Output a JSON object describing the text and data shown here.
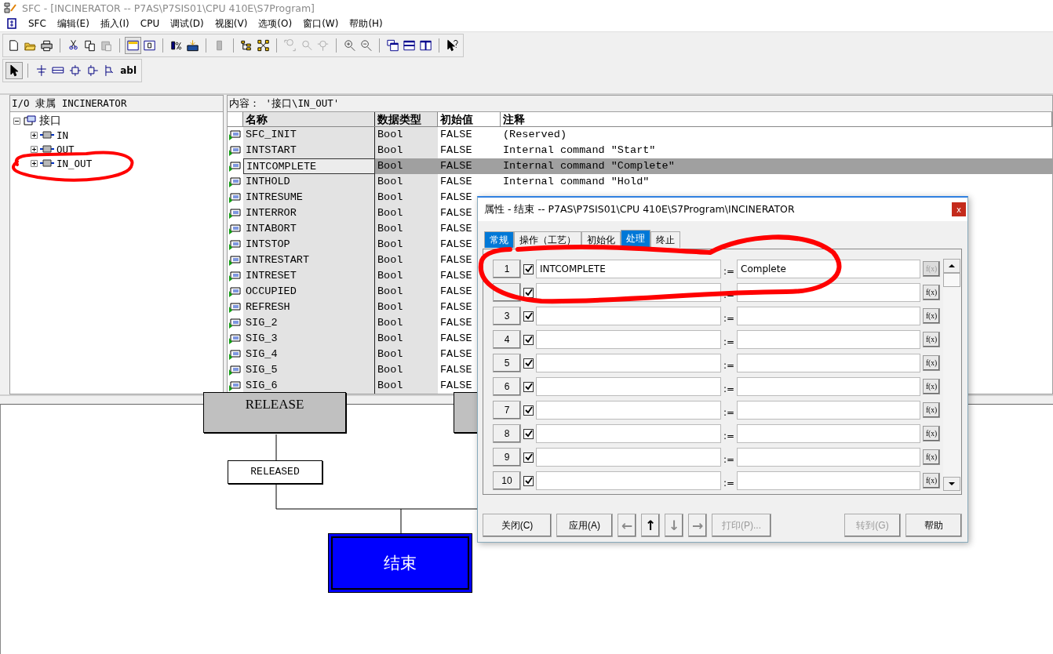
{
  "window": {
    "title": "SFC - [INCINERATOR -- P7AS\\P7SIS01\\CPU 410E\\S7Program]"
  },
  "menu": [
    "SFC",
    "编辑(E)",
    "插入(I)",
    "CPU",
    "调试(D)",
    "视图(V)",
    "选项(O)",
    "窗口(W)",
    "帮助(H)"
  ],
  "drawing_toolbar": {
    "text_tool": "abl"
  },
  "tree": {
    "header": "I/O 隶属 INCINERATOR",
    "items": [
      {
        "label": "接口",
        "expanded": true,
        "children": [
          {
            "label": "IN",
            "expanded": false
          },
          {
            "label": "OUT",
            "expanded": false
          },
          {
            "label": "IN_OUT",
            "expanded": false
          }
        ]
      }
    ]
  },
  "table": {
    "caption": "内容： '接口\\IN_OUT'",
    "columns": [
      "名称",
      "数据类型",
      "初始值",
      "注释"
    ],
    "rows": [
      {
        "name": "SFC_INIT",
        "type": "Bool",
        "initial": "FALSE",
        "comment": "(Reserved)",
        "selected": false
      },
      {
        "name": "INTSTART",
        "type": "Bool",
        "initial": "FALSE",
        "comment": "Internal command \"Start\"",
        "selected": false
      },
      {
        "name": "INTCOMPLETE",
        "type": "Bool",
        "initial": "FALSE",
        "comment": "Internal command \"Complete\"",
        "selected": true
      },
      {
        "name": "INTHOLD",
        "type": "Bool",
        "initial": "FALSE",
        "comment": "Internal command \"Hold\"",
        "selected": false
      },
      {
        "name": "INTRESUME",
        "type": "Bool",
        "initial": "FALSE",
        "selected": false
      },
      {
        "name": "INTERROR",
        "type": "Bool",
        "initial": "FALSE",
        "selected": false
      },
      {
        "name": "INTABORT",
        "type": "Bool",
        "initial": "FALSE",
        "selected": false
      },
      {
        "name": "INTSTOP",
        "type": "Bool",
        "initial": "FALSE",
        "selected": false
      },
      {
        "name": "INTRESTART",
        "type": "Bool",
        "initial": "FALSE",
        "selected": false
      },
      {
        "name": "INTRESET",
        "type": "Bool",
        "initial": "FALSE",
        "selected": false
      },
      {
        "name": "OCCUPIED",
        "type": "Bool",
        "initial": "FALSE",
        "selected": false
      },
      {
        "name": "REFRESH",
        "type": "Bool",
        "initial": "FALSE",
        "selected": false
      },
      {
        "name": "SIG_2",
        "type": "Bool",
        "initial": "FALSE",
        "selected": false
      },
      {
        "name": "SIG_3",
        "type": "Bool",
        "initial": "FALSE",
        "selected": false
      },
      {
        "name": "SIG_4",
        "type": "Bool",
        "initial": "FALSE",
        "selected": false
      },
      {
        "name": "SIG_5",
        "type": "Bool",
        "initial": "FALSE",
        "selected": false
      },
      {
        "name": "SIG_6",
        "type": "Bool",
        "initial": "FALSE",
        "selected": false
      }
    ]
  },
  "sfc": {
    "step": "RELEASE",
    "transition": "RELEASED",
    "end_step": "结束"
  },
  "dialog": {
    "title": "属性 -  结束 -- P7AS\\P7SIS01\\CPU 410E\\S7Program\\INCINERATOR",
    "close": "x",
    "tabs": [
      {
        "label": "常规",
        "selected": false,
        "highlighted": true
      },
      {
        "label": "操作（工艺）",
        "selected": false,
        "highlighted": false
      },
      {
        "label": "初始化",
        "selected": false,
        "highlighted": false
      },
      {
        "label": "处理",
        "selected": true,
        "highlighted": true
      },
      {
        "label": "终止",
        "selected": false,
        "highlighted": false
      }
    ],
    "rows": [
      {
        "number": "1",
        "checked": true,
        "operand": "INTCOMPLETE",
        "assign": ":=",
        "value": "Complete",
        "fx": "f(x)",
        "fx_disabled": true
      },
      {
        "checked": true,
        "assign": ":=",
        "fx": "f(x)",
        "fx_disabled": false
      },
      {
        "number": "3",
        "checked": true,
        "assign": ":=",
        "fx": "f(x)",
        "fx_disabled": false
      },
      {
        "number": "4",
        "checked": true,
        "assign": ":=",
        "fx": "f(x)",
        "fx_disabled": false
      },
      {
        "number": "5",
        "checked": true,
        "assign": ":=",
        "fx": "f(x)",
        "fx_disabled": false
      },
      {
        "number": "6",
        "checked": true,
        "assign": ":=",
        "fx": "f(x)",
        "fx_disabled": false
      },
      {
        "number": "7",
        "checked": true,
        "assign": ":=",
        "fx": "f(x)",
        "fx_disabled": false
      },
      {
        "number": "8",
        "checked": true,
        "assign": ":=",
        "fx": "f(x)",
        "fx_disabled": false
      },
      {
        "number": "9",
        "checked": true,
        "assign": ":=",
        "fx": "f(x)",
        "fx_disabled": false
      },
      {
        "number": "10",
        "checked": true,
        "assign": ":=",
        "fx": "f(x)",
        "fx_disabled": false
      }
    ],
    "buttons": [
      {
        "kind": "text",
        "label": "关闭(C)",
        "disabled": false
      },
      {
        "kind": "text",
        "label": "应用(A)",
        "disabled": false
      },
      {
        "kind": "arrow",
        "label": "←",
        "disabled": true
      },
      {
        "kind": "arrow",
        "label": "↑",
        "disabled": false
      },
      {
        "kind": "arrow",
        "label": "↓",
        "disabled": true
      },
      {
        "kind": "arrow",
        "label": "→",
        "disabled": true
      },
      {
        "kind": "text",
        "label": "打印(P)...",
        "disabled": true
      },
      {
        "kind": "spacer"
      },
      {
        "kind": "text",
        "label": "转到(G)",
        "disabled": true
      },
      {
        "kind": "text",
        "label": "帮助",
        "disabled": false
      }
    ]
  }
}
